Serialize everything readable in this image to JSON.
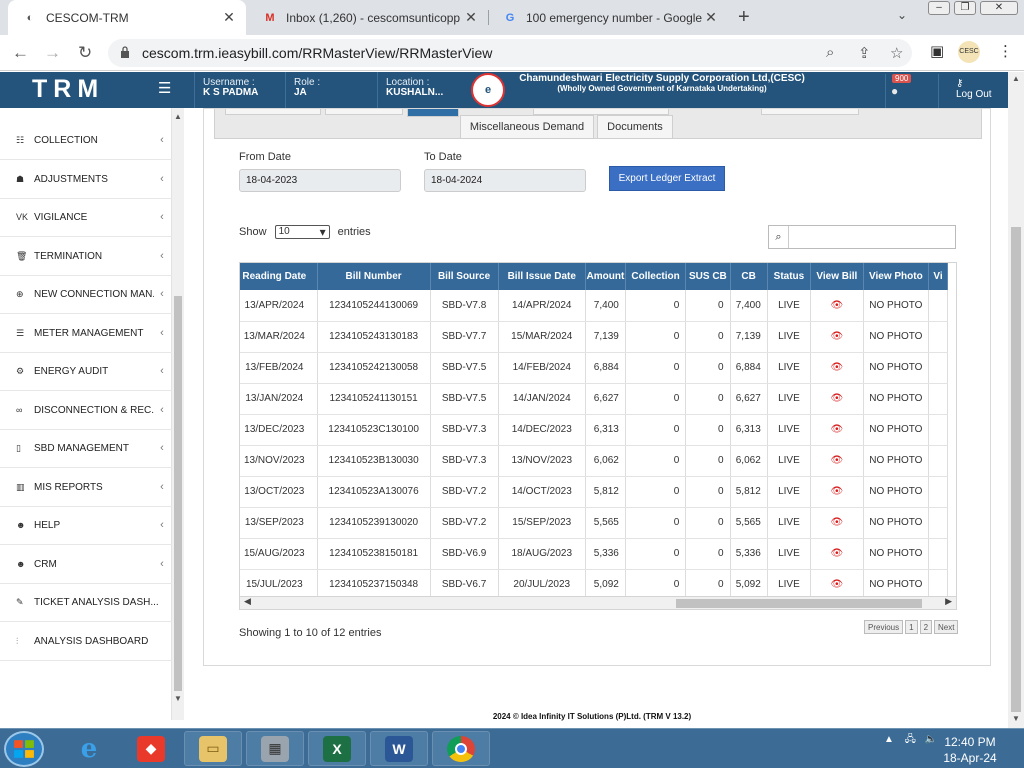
{
  "browser": {
    "tabs": [
      {
        "title": "CESCOM-TRM",
        "icon": "cesc-favicon"
      },
      {
        "title": "Inbox (1,260) - cescomsunticopp",
        "icon": "gmail-icon"
      },
      {
        "title": "100 emergency number - Google",
        "icon": "google-icon"
      }
    ],
    "url": "cescom.trm.ieasybill.com/RRMasterView/RRMasterView"
  },
  "header": {
    "logo": "TRM",
    "username_label": "Username :",
    "username": "K S PADMA",
    "role_label": "Role :",
    "role": "JA",
    "location_label": "Location :",
    "location": "KUSHALN...",
    "org_line1": "Chamundeshwari Electricity Supply Corporation Ltd,(CESC)",
    "org_line2": "(Wholly Owned Government of Karnataka Undertaking)",
    "notification_count": "900",
    "logout_label": "Log Out"
  },
  "sidebar": {
    "items": [
      {
        "label": "COLLECTION",
        "icon": "list-icon"
      },
      {
        "label": "ADJUSTMENTS",
        "icon": "adjust-icon"
      },
      {
        "label": "VIGILANCE",
        "icon": "vk-icon"
      },
      {
        "label": "TERMINATION",
        "icon": "trash-icon"
      },
      {
        "label": "NEW CONNECTION MAN...",
        "icon": "plus-circle-icon"
      },
      {
        "label": "METER MANAGEMENT",
        "icon": "list-icon"
      },
      {
        "label": "ENERGY AUDIT",
        "icon": "gears-icon"
      },
      {
        "label": "DISCONNECTION & REC...",
        "icon": "link-icon"
      },
      {
        "label": "SBD MANAGEMENT",
        "icon": "mobile-icon"
      },
      {
        "label": "MIS REPORTS",
        "icon": "bar-chart-icon"
      },
      {
        "label": "HELP",
        "icon": "users-icon"
      },
      {
        "label": "CRM",
        "icon": "users-icon"
      },
      {
        "label": "TICKET ANALYSIS DASH...",
        "icon": "wrench-icon"
      },
      {
        "label": "ANALYSIS DASHBOARD",
        "icon": "chart-icon"
      }
    ]
  },
  "main": {
    "tabs": [
      "Miscellaneous Demand",
      "Documents"
    ],
    "from_date_label": "From Date",
    "from_date": "18-04-2023",
    "to_date_label": "To Date",
    "to_date": "18-04-2024",
    "export_label": "Export Ledger Extract",
    "show_label": "Show",
    "show_value": "10",
    "entries_label": "entries",
    "search_value": "",
    "showing": "Showing 1 to 10 of 12 entries",
    "pager": [
      "Previous",
      "1",
      "2",
      "Next"
    ]
  },
  "table": {
    "columns": [
      "Reading Date",
      "Bill Number",
      "Bill Source",
      "Bill Issue Date",
      "Amount",
      "Collection",
      "SUS CB",
      "CB",
      "Status",
      "View Bill",
      "View Photo",
      "Vi"
    ],
    "rows": [
      [
        "13/APR/2024",
        "1234105244130069",
        "SBD-V7.8",
        "14/APR/2024",
        "7,400",
        "0",
        "0",
        "7,400",
        "LIVE",
        "NO PHOTO"
      ],
      [
        "13/MAR/2024",
        "1234105243130183",
        "SBD-V7.7",
        "15/MAR/2024",
        "7,139",
        "0",
        "0",
        "7,139",
        "LIVE",
        "NO PHOTO"
      ],
      [
        "13/FEB/2024",
        "1234105242130058",
        "SBD-V7.5",
        "14/FEB/2024",
        "6,884",
        "0",
        "0",
        "6,884",
        "LIVE",
        "NO PHOTO"
      ],
      [
        "13/JAN/2024",
        "1234105241130151",
        "SBD-V7.5",
        "14/JAN/2024",
        "6,627",
        "0",
        "0",
        "6,627",
        "LIVE",
        "NO PHOTO"
      ],
      [
        "13/DEC/2023",
        "123410523C130100",
        "SBD-V7.3",
        "14/DEC/2023",
        "6,313",
        "0",
        "0",
        "6,313",
        "LIVE",
        "NO PHOTO"
      ],
      [
        "13/NOV/2023",
        "123410523B130030",
        "SBD-V7.3",
        "13/NOV/2023",
        "6,062",
        "0",
        "0",
        "6,062",
        "LIVE",
        "NO PHOTO"
      ],
      [
        "13/OCT/2023",
        "123410523A130076",
        "SBD-V7.2",
        "14/OCT/2023",
        "5,812",
        "0",
        "0",
        "5,812",
        "LIVE",
        "NO PHOTO"
      ],
      [
        "13/SEP/2023",
        "1234105239130020",
        "SBD-V7.2",
        "15/SEP/2023",
        "5,565",
        "0",
        "0",
        "5,565",
        "LIVE",
        "NO PHOTO"
      ],
      [
        "15/AUG/2023",
        "1234105238150181",
        "SBD-V6.9",
        "18/AUG/2023",
        "5,336",
        "0",
        "0",
        "5,336",
        "LIVE",
        "NO PHOTO"
      ],
      [
        "15/JUL/2023",
        "1234105237150348",
        "SBD-V6.7",
        "20/JUL/2023",
        "5,092",
        "0",
        "0",
        "5,092",
        "LIVE",
        "NO PHOTO"
      ]
    ]
  },
  "footer": "2024 © Idea Infinity IT Solutions (P)Ltd. (TRM V 13.2)",
  "taskbar": {
    "time": "12:40 PM",
    "date": "18-Apr-24"
  },
  "colors": {
    "header_bg": "#24547c",
    "table_header_bg": "#34699a",
    "export_button": "#3a6fc4",
    "view_bill_icon": "#d81b1b"
  }
}
